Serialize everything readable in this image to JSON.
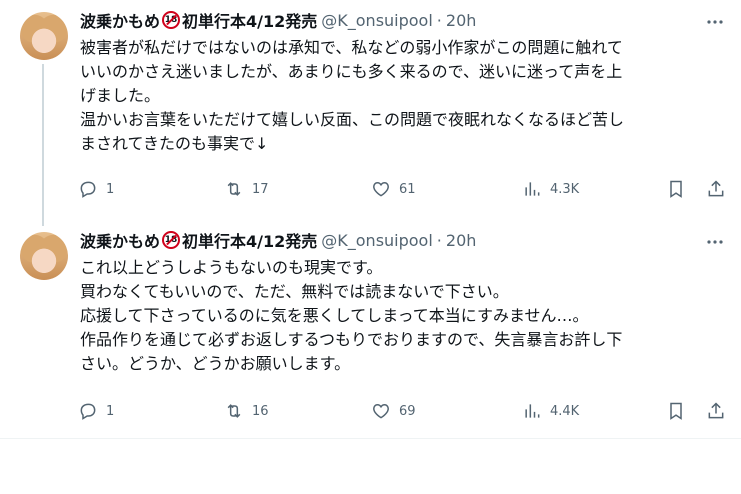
{
  "tweets": [
    {
      "author_name": "波乗かもめ",
      "badge": "18",
      "author_suffix": "初単行本4/12発売",
      "handle": "@K_onsuipool",
      "separator": "·",
      "time": "20h",
      "text": "被害者が私だけではないのは承知で、私などの弱小作家がこの問題に触れて\nいいのかさえ迷いましたが、あまりにも多く来るので、迷いに迷って声を上\nげました。\n温かいお言葉をいただけて嬉しい反面、この問題で夜眠れなくなるほど苦し\nまされてきたのも事実で↓",
      "replies": "1",
      "retweets": "17",
      "likes": "61",
      "views": "4.3K"
    },
    {
      "author_name": "波乗かもめ",
      "badge": "18",
      "author_suffix": "初単行本4/12発売",
      "handle": "@K_onsuipool",
      "separator": "·",
      "time": "20h",
      "text": "これ以上どうしようもないのも現実です。\n買わなくてもいいので、ただ、無料では読まないで下さい。\n応援して下さっているのに気を悪くしてしまって本当にすみません…。\n作品作りを通じて必ずお返しするつもりでおりますので、失言暴言お許し下\nさい。どうか、どうかお願いします。",
      "replies": "1",
      "retweets": "16",
      "likes": "69",
      "views": "4.4K"
    }
  ],
  "icons": {
    "reply": "reply-icon",
    "retweet": "retweet-icon",
    "like": "heart-icon",
    "views": "views-icon",
    "bookmark": "bookmark-icon",
    "share": "share-icon",
    "more": "more-icon"
  }
}
